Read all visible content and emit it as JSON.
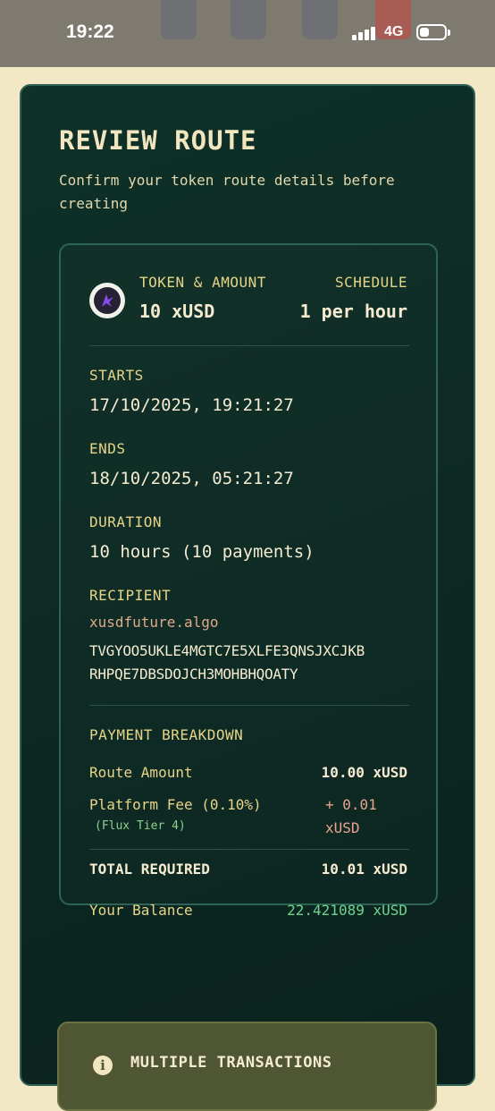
{
  "status_bar": {
    "time": "19:22",
    "network": "4G",
    "icons": [
      "signal-icon",
      "battery-icon"
    ]
  },
  "page": {
    "title": "REVIEW ROUTE",
    "subtitle": "Confirm your token route details before creating"
  },
  "summary": {
    "token_amount_label": "TOKEN & AMOUNT",
    "token_amount_value": "10 xUSD",
    "schedule_label": "SCHEDULE",
    "schedule_value": "1 per hour",
    "token_icon": "token-logo-icon"
  },
  "details": {
    "starts_label": "STARTS",
    "starts_value": "17/10/2025, 19:21:27",
    "ends_label": "ENDS",
    "ends_value": "18/10/2025, 05:21:27",
    "duration_label": "DURATION",
    "duration_value": "10 hours (10 payments)",
    "recipient_label": "RECIPIENT",
    "recipient_name": "xusdfuture.algo",
    "recipient_address_line1": "TVGYOO5UKLE4MGTC7E5XLFE3QNSJXCJKB",
    "recipient_address_line2": "RHPQE7DBSDOJCH3MOHBHQOATY"
  },
  "breakdown": {
    "label": "PAYMENT BREAKDOWN",
    "route_amount_label": "Route Amount",
    "route_amount_value": "10.00 xUSD",
    "fee_label": "Platform Fee (0.10%)",
    "fee_tier": "(Flux Tier 4)",
    "fee_value_line1": "+ 0.01",
    "fee_value_line2": "xUSD",
    "total_label": "TOTAL REQUIRED",
    "total_value": "10.01 xUSD",
    "balance_label": "Your Balance",
    "balance_value": "22.421089 xUSD"
  },
  "notice": {
    "title": "MULTIPLE TRANSACTIONS",
    "icon": "info-icon"
  },
  "colors": {
    "page_bg": "#f3e8c6",
    "card_bg": "#0f3128",
    "label": "#e7d488",
    "recipient_name": "#e0a98c",
    "fee": "#e8a48f",
    "balance": "#6fd38e",
    "tier": "#8fd18d"
  }
}
